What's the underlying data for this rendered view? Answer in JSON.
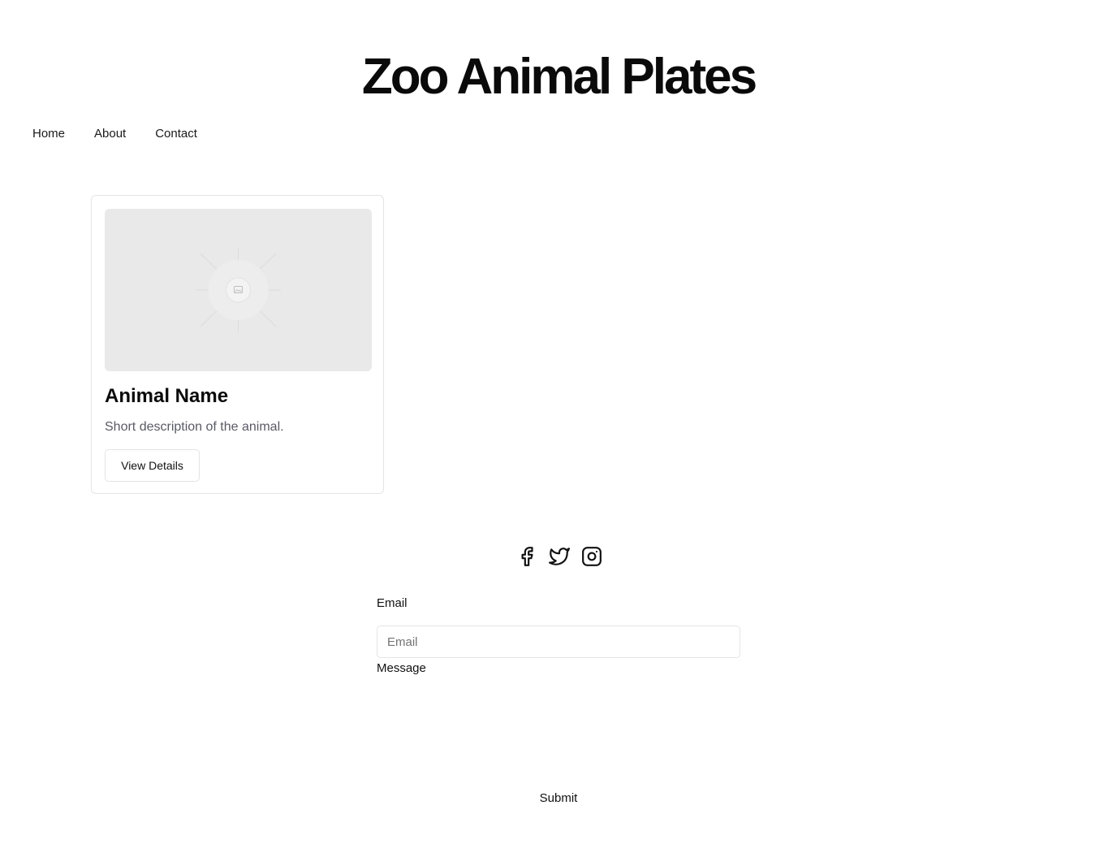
{
  "header": {
    "title": "Zoo Animal Plates"
  },
  "nav": {
    "items": [
      {
        "label": "Home"
      },
      {
        "label": "About"
      },
      {
        "label": "Contact"
      }
    ]
  },
  "card": {
    "image_icon": "image-placeholder-icon",
    "title": "Animal Name",
    "description": "Short description of the animal.",
    "button_label": "View Details"
  },
  "social": {
    "icons": [
      "facebook-icon",
      "twitter-icon",
      "instagram-icon"
    ]
  },
  "form": {
    "email_label": "Email",
    "email_placeholder": "Email",
    "email_value": "",
    "message_label": "Message",
    "message_value": "",
    "submit_label": "Submit"
  },
  "colors": {
    "text": "#0a0a0a",
    "muted_text": "#5a5a66",
    "border": "#e4e4e7",
    "placeholder_bg": "#e9e9e9"
  }
}
